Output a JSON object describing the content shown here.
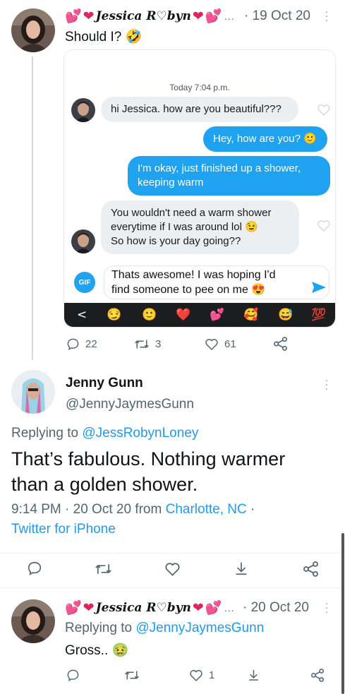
{
  "tweet1": {
    "display_name": "Jessica R♡byn",
    "date": "· 19 Oct 20",
    "ellipsis": "...",
    "text": "Should I? 🤣",
    "chat": {
      "timestamp": "Today 7:04 p.m.",
      "msg1": "hi Jessica. how are you beautiful???",
      "msg2": "Hey, how are you? 🙂",
      "msg3_line1": "I'm okay, just finished up a shower,",
      "msg3_line2": "keeping warm",
      "msg4_line1": "You wouldn't need a warm shower",
      "msg4_line2": "everytime if I was around lol 😉",
      "msg4_line3": "So how is your day going??",
      "gif_label": "GIF",
      "input_line1": "Thats awesome! I was hoping I'd",
      "input_line2": "find someone to pee on me 😍",
      "keyboard": [
        "<",
        "😏",
        "🙂",
        "❤️",
        "💕",
        "🥰",
        "😅",
        "💯"
      ]
    },
    "replies": "22",
    "retweets": "3",
    "likes": "61"
  },
  "tweet2": {
    "display_name": "Jenny Gunn",
    "handle": "@JennyJaymesGunn",
    "replying_prefix": "Replying to ",
    "replying_handle": "@JessRobynLoney",
    "text_line1": "That’s fabulous. Nothing warmer",
    "text_line2": "than a golden shower.",
    "time": "9:14 PM · 20 Oct 20 from ",
    "location": "Charlotte, NC",
    "location_suffix": " ·",
    "source": "Twitter for iPhone"
  },
  "tweet3": {
    "display_name": "Jessica R♡byn",
    "ellipsis": "...",
    "date": "· 20 Oct 20",
    "replying_prefix": "Replying to ",
    "replying_handle": "@JennyJaymesGunn",
    "text": "Gross.. 🤢",
    "likes": "1"
  },
  "colors": {
    "accent": "#1d9bf0",
    "bubble_out": "#1fa2f0",
    "heart": "#e0245e",
    "muted": "#536471"
  }
}
